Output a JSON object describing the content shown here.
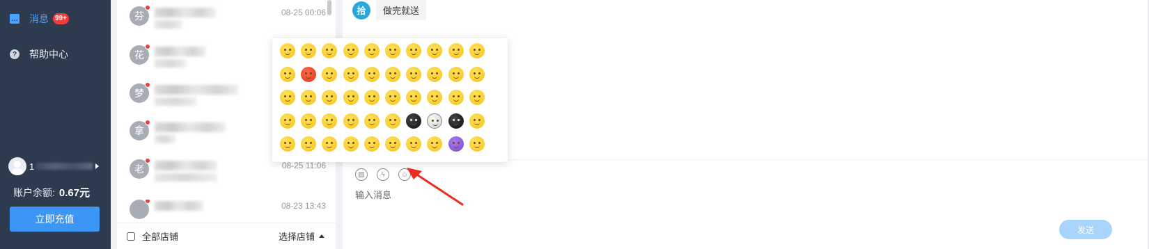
{
  "sidebar": {
    "nav": [
      {
        "label": "消息",
        "badge": "99+",
        "icon": "message-icon",
        "active": true
      },
      {
        "label": "帮助中心",
        "icon": "help-icon",
        "active": false
      }
    ],
    "user": {
      "name_prefix": "1"
    },
    "balance_label": "账户余额:",
    "balance_value": "0.67元",
    "recharge_button": "立即充值"
  },
  "conversations": [
    {
      "avatar_char": "芬",
      "time": "08-25 00:06",
      "unread": true
    },
    {
      "avatar_char": "花",
      "time": "",
      "unread": true
    },
    {
      "avatar_char": "梦",
      "time": "",
      "unread": true
    },
    {
      "avatar_char": "拿",
      "time": "",
      "unread": true
    },
    {
      "avatar_char": "老",
      "time": "08-25 11:06",
      "unread": true
    },
    {
      "avatar_char": "",
      "time": "08-23 13:43",
      "unread": true
    }
  ],
  "conv_footer": {
    "all_stores": "全部店铺",
    "choose_store": "选择店铺"
  },
  "chat": {
    "avatar_char": "拾",
    "message": "做完就送",
    "input_placeholder": "输入消息",
    "send_button": "发送",
    "toolbar": [
      "image-icon",
      "lightning-icon",
      "emoji-icon"
    ]
  },
  "emoji_panel": {
    "rows": 5,
    "cols": 10,
    "colors": {
      "yellow": "#f7c21a",
      "red": "#e0331a",
      "purple": "#7a48d8",
      "gray": "#cfcfcf",
      "black": "#111111"
    }
  },
  "annotation": {
    "color": "#f02a1c",
    "type": "arrow"
  }
}
